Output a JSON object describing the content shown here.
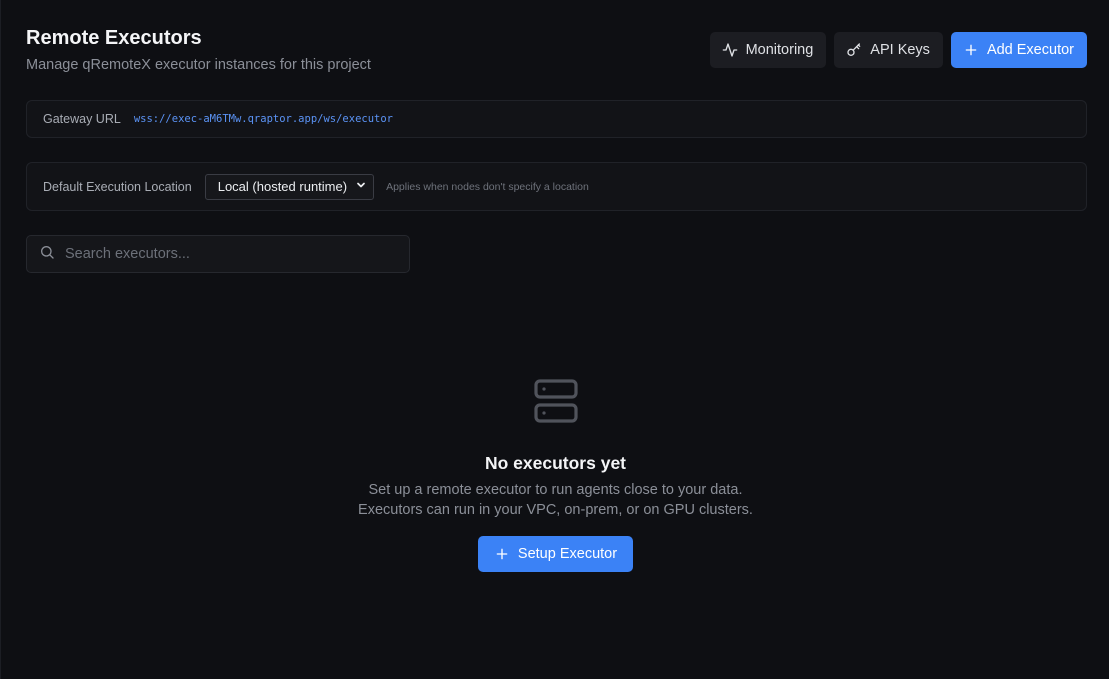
{
  "header": {
    "title": "Remote Executors",
    "subtitle": "Manage qRemoteX executor instances for this project"
  },
  "toolbar": {
    "monitoring_label": "Monitoring",
    "api_keys_label": "API Keys",
    "add_executor_label": "Add Executor"
  },
  "gateway": {
    "label": "Gateway URL",
    "url": "wss://exec-aM6TMw.qraptor.app/ws/executor"
  },
  "execution_location": {
    "label": "Default Execution Location",
    "selected": "Local (hosted runtime)",
    "hint": "Applies when nodes don't specify a location"
  },
  "search": {
    "placeholder": "Search executors..."
  },
  "empty_state": {
    "title": "No executors yet",
    "line1": "Set up a remote executor to run agents close to your data.",
    "line2": "Executors can run in your VPC, on-prem, or on GPU clusters.",
    "button_label": "Setup Executor"
  },
  "colors": {
    "background": "#0e0f13",
    "accent": "#3b82f6",
    "url_text": "#5b93f5"
  },
  "icons": {
    "monitoring": "activity-icon",
    "api_keys": "key-icon",
    "add": "plus-icon",
    "search": "search-icon",
    "empty": "server-icon",
    "select": "chevron-down-icon"
  }
}
